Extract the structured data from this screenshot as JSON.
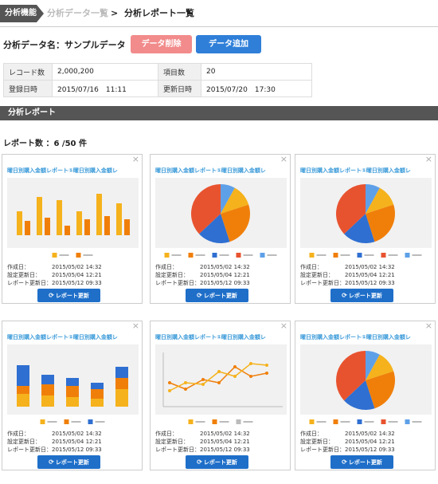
{
  "breadcrumb": {
    "first": "分析機能",
    "second": "分析データ一覧",
    "sep": ">",
    "current": "分析レポート一覧"
  },
  "header": {
    "data_name": "分析データ名：サンプルデータ",
    "delete_label": "データ削除",
    "add_label": "データ追加"
  },
  "info": {
    "record_label": "レコード数",
    "record_value": "2,000,200",
    "items_label": "項目数",
    "items_value": "20",
    "registered_label": "登録日時",
    "registered_value": "2015/07/16　11:11",
    "updated_label": "更新日時",
    "updated_value": "2015/07/20　17:30"
  },
  "section_title": "分析レポート",
  "report_count": "レポート数 ：6 /50 件",
  "card_common": {
    "title": "曜日別購入金額レポート①曜日別購入金額レ",
    "close": "×",
    "created_label": "作成日：",
    "created_value": "2015/05/02 14:32",
    "setting_label": "設定更新日：",
    "setting_value": "2015/05/04 12:21",
    "report_label": "レポート更新日：",
    "report_value": "2015/05/12 09:33",
    "update_button": "レポート更新"
  },
  "colors": {
    "yellow": "#f5b21c",
    "orange": "#f07f0a",
    "red": "#e8532f",
    "blue": "#2f6fd1",
    "lightblue": "#5ea0e8",
    "gray": "#bbbbbb"
  },
  "cards": [
    {
      "chart": "bar"
    },
    {
      "chart": "pie"
    },
    {
      "chart": "pie"
    },
    {
      "chart": "stacked-bar"
    },
    {
      "chart": "line"
    },
    {
      "chart": "pie"
    }
  ]
}
